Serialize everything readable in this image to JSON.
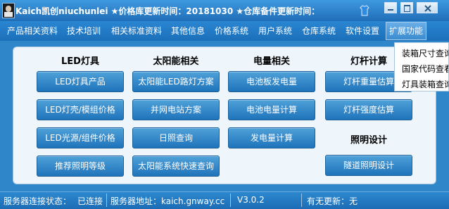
{
  "window": {
    "title": "Kaich凯创niuchunlei ★价格库更新时间：20181030 ★仓库备件更新时间："
  },
  "menu": {
    "items": [
      {
        "label": "产品相关资料"
      },
      {
        "label": "技术培训"
      },
      {
        "label": "相关标准资料"
      },
      {
        "label": "其他信息"
      },
      {
        "label": "价格系统"
      },
      {
        "label": "用户系统"
      },
      {
        "label": "仓库系统"
      },
      {
        "label": "软件设置"
      },
      {
        "label": "扩展功能",
        "active": true
      }
    ]
  },
  "dropdown": {
    "items": [
      {
        "label": "装箱尺寸查询"
      },
      {
        "label": "国家代码查看"
      },
      {
        "label": "灯具装箱查询"
      }
    ]
  },
  "columns": [
    {
      "heading": "LED灯具",
      "buttons": [
        {
          "label": "LED灯具产品"
        },
        {
          "label": "LED灯壳/模组价格"
        },
        {
          "label": "LED光源/组件价格"
        },
        {
          "label": "推荐照明等级"
        }
      ]
    },
    {
      "heading": "太阳能相关",
      "buttons": [
        {
          "label": "太阳能LED路灯方案"
        },
        {
          "label": "并网电站方案"
        },
        {
          "label": "日照查询"
        },
        {
          "label": "太阳能系统快速查询"
        }
      ]
    },
    {
      "heading": "电量相关",
      "buttons": [
        {
          "label": "电池板发电量"
        },
        {
          "label": "电池电量计算"
        },
        {
          "label": "发电量计算"
        }
      ]
    },
    {
      "heading": "灯杆计算",
      "buttons": [
        {
          "label": "灯杆重量估算"
        },
        {
          "label": "灯杆强度估算"
        }
      ]
    }
  ],
  "lighting_design": {
    "heading": "照明设计",
    "button": {
      "label": "隧道照明设计"
    }
  },
  "status": {
    "connection_label": "服务器连接状态：",
    "connection_value": "已连接",
    "server_label": "服务器地址：kaich.gnway.cc",
    "version": "V3.0.2",
    "update_label": "有无更新：无"
  },
  "colors": {
    "titlebar": "#1f6db8",
    "menubar": "#1c6fb9",
    "button": "#2b7fc2",
    "content_bg": "#eef5fb",
    "statusbar": "#1c6cb4"
  },
  "icons": [
    "app-avatar-icon",
    "tshirt-skin-icon",
    "minimize-icon",
    "maximize-icon",
    "close-icon"
  ]
}
